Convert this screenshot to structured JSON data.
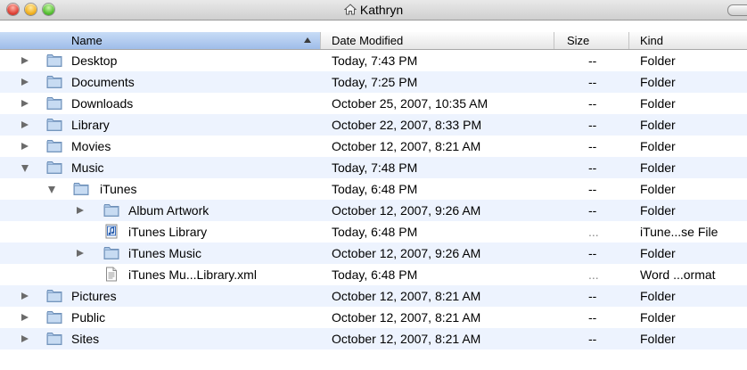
{
  "window": {
    "title": "Kathryn",
    "title_icon": "home-icon"
  },
  "columns": {
    "name": "Name",
    "date": "Date Modified",
    "size": "Size",
    "kind": "Kind"
  },
  "rows": [
    {
      "name": "Desktop",
      "date": "Today, 7:43 PM",
      "size": "--",
      "kind": "Folder",
      "icon": "folder-icon"
    },
    {
      "name": "Documents",
      "date": "Today, 7:25 PM",
      "size": "--",
      "kind": "Folder",
      "icon": "folder-icon"
    },
    {
      "name": "Downloads",
      "date": "October 25, 2007, 10:35 AM",
      "size": "--",
      "kind": "Folder",
      "icon": "folder-icon"
    },
    {
      "name": "Library",
      "date": "October 22, 2007, 8:33 PM",
      "size": "--",
      "kind": "Folder",
      "icon": "folder-icon"
    },
    {
      "name": "Movies",
      "date": "October 12, 2007, 8:21 AM",
      "size": "--",
      "kind": "Folder",
      "icon": "folder-icon"
    },
    {
      "name": "Music",
      "date": "Today, 7:48 PM",
      "size": "--",
      "kind": "Folder",
      "icon": "folder-icon"
    },
    {
      "name": "iTunes",
      "date": "Today, 6:48 PM",
      "size": "--",
      "kind": "Folder",
      "icon": "folder-icon"
    },
    {
      "name": "Album Artwork",
      "date": "October 12, 2007, 9:26 AM",
      "size": "--",
      "kind": "Folder",
      "icon": "folder-icon"
    },
    {
      "name": "iTunes Library",
      "date": "Today, 6:48 PM",
      "size": "...",
      "kind": "iTune...se File",
      "icon": "itunes-file-icon"
    },
    {
      "name": "iTunes Music",
      "date": "October 12, 2007, 9:26 AM",
      "size": "--",
      "kind": "Folder",
      "icon": "folder-icon"
    },
    {
      "name": "iTunes Mu...Library.xml",
      "date": "Today, 6:48 PM",
      "size": "...",
      "kind": "Word ...ormat",
      "icon": "document-icon"
    },
    {
      "name": "Pictures",
      "date": "October 12, 2007, 8:21 AM",
      "size": "--",
      "kind": "Folder",
      "icon": "folder-icon"
    },
    {
      "name": "Public",
      "date": "October 12, 2007, 8:21 AM",
      "size": "--",
      "kind": "Folder",
      "icon": "folder-icon"
    },
    {
      "name": "Sites",
      "date": "October 12, 2007, 8:21 AM",
      "size": "--",
      "kind": "Folder",
      "icon": "folder-icon"
    }
  ]
}
